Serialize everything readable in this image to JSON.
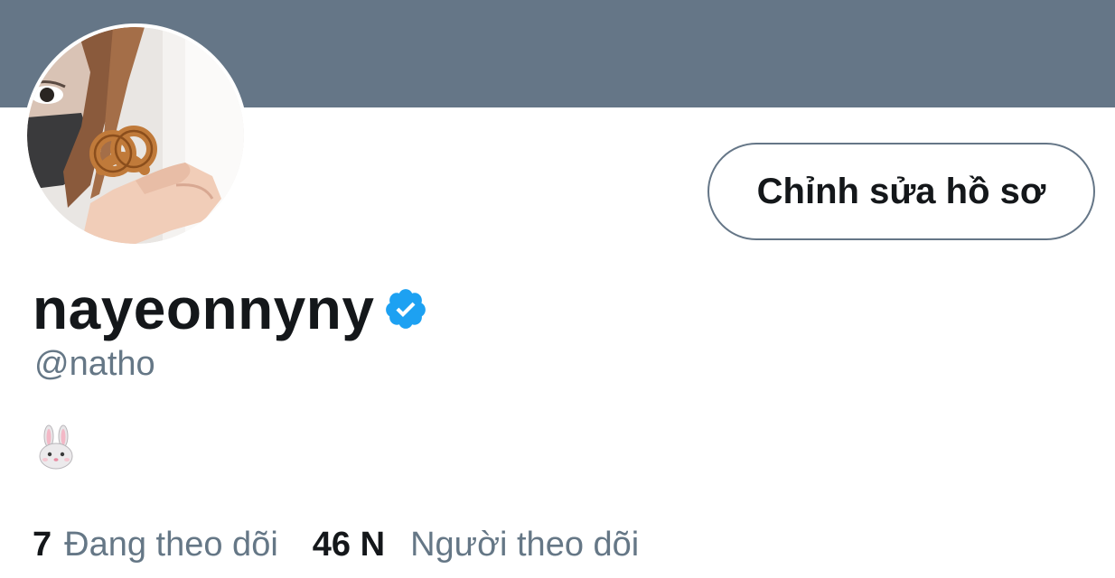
{
  "colors": {
    "banner": "#657687",
    "text_primary": "#14171a",
    "text_secondary": "#657786",
    "verified": "#1da1f2",
    "button_border": "#657687"
  },
  "profile": {
    "avatar_icon": "profile-photo",
    "edit_button_label": "Chỉnh sửa hồ sơ",
    "display_name": "nayeonnyny",
    "verified_icon": "verified-badge-icon",
    "handle": "@natho",
    "bio_emoji": "rabbit-face-emoji"
  },
  "stats": {
    "following_count": "7",
    "following_label": "Đang theo dõi",
    "followers_count": "46 N",
    "followers_label": "Người theo dõi"
  }
}
